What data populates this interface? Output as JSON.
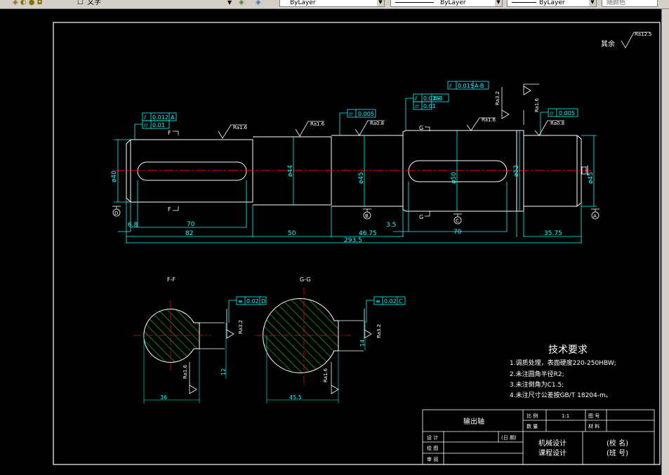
{
  "toolbar": {
    "text_style": "文字",
    "layer": "ByLayer",
    "linetype": "ByLayer",
    "lineweight": "ByLayer",
    "color": "随颜色"
  },
  "drawing": {
    "roughness_other": "其余",
    "roughness": {
      "ra125": "Ra12.5",
      "ra16": "Ra1.6",
      "ra08": "Ra0.8",
      "ra32": "Ra3.2"
    },
    "tolerances": {
      "t1_a": "0.012",
      "t1_a_ref": "A",
      "t1_b": "0.01",
      "t2": "0.005",
      "t3_a": "0.015",
      "t3_a_ref": "A-B",
      "t3_b": "0.01",
      "t4": "0.015",
      "t4_ref": "A-B",
      "t5": "0.005",
      "sec1": "0.02",
      "sec1_ref": "D",
      "sec2": "0.02",
      "sec2_ref": "C"
    },
    "section_marks": {
      "f": "F",
      "g": "G"
    },
    "datums": {
      "d": "D",
      "b": "B",
      "c": "C",
      "a": "A"
    },
    "diameters": {
      "d40": "ø40",
      "d44": "ø44",
      "d45a": "ø45",
      "d50": "ø50",
      "d52": "ø52",
      "d45b": "ø45"
    },
    "dims": {
      "d68": "6.8",
      "d70a": "70",
      "d82": "82",
      "d50": "50",
      "d4675": "46.75",
      "d35": "3.5",
      "d70b": "70",
      "d3575": "35.75",
      "d2935": "293.5"
    },
    "sections": {
      "ff_label": "F-F",
      "gg_label": "G-G",
      "ff_width": "36",
      "gg_width": "45.5",
      "ff_key": "12",
      "gg_key": "14"
    },
    "tech_req": {
      "title": "技术要求",
      "items": [
        "1.调质处理，表面硬度220-250HBW;",
        "2.未注圆角半径R2;",
        "3.未注倒角为C1.5;",
        "4.未注尺寸公差按GB/T 18204-m。"
      ]
    },
    "title_block": {
      "part_name": "输出轴",
      "scale_label": "比 例",
      "scale_value": "1:1",
      "drawing_no_label": "图 号",
      "qty_label": "数 量",
      "material_label": "材 料",
      "designer_label": "设 计",
      "date_label": "(日 期)",
      "drawer_label": "绘 图",
      "checker_label": "审 阅",
      "course_1": "机械设计",
      "course_2": "课程设计",
      "school": "(校  名)",
      "class": "(班  号)"
    }
  },
  "colors": {
    "cyan": "#00ffff",
    "white": "#ffffff",
    "red": "#ff0000",
    "green": "#00ff00",
    "background": "#000000"
  }
}
